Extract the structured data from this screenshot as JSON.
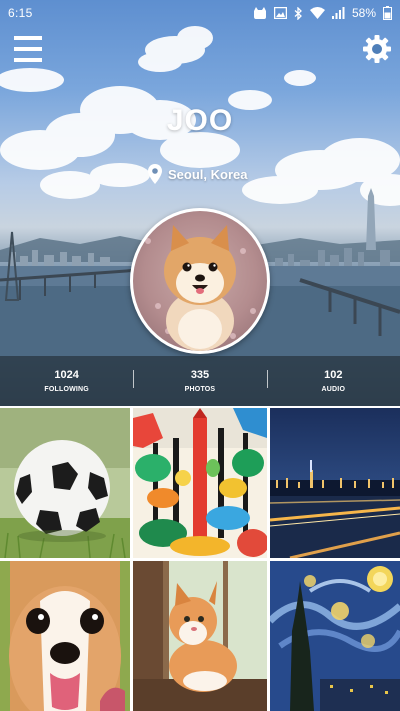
{
  "status_bar": {
    "time": "6:15",
    "battery_percent": "58%",
    "icons": [
      "cat-notification-icon",
      "photo-notification-icon",
      "bluetooth-icon",
      "wifi-icon",
      "signal-icon",
      "battery-icon"
    ]
  },
  "toolbar": {
    "menu_icon": "hamburger-menu-icon",
    "settings_icon": "gear-icon"
  },
  "profile": {
    "name": "JOO",
    "location": "Seoul, Korea",
    "location_icon": "location-pin-icon",
    "avatar": "pomeranian-dog-photo"
  },
  "stats": [
    {
      "value": "1024",
      "label": "FOLLOWING"
    },
    {
      "value": "335",
      "label": "PHOTOS"
    },
    {
      "value": "102",
      "label": "AUDIO"
    }
  ],
  "photos": [
    "soccer-ball-photo",
    "colorful-forest-painting",
    "city-night-photo",
    "corgi-puppy-photo",
    "cat-by-window-photo",
    "starry-night-painting"
  ],
  "colors": {
    "stats_bar_bg": "#28343e",
    "text": "#ffffff"
  }
}
